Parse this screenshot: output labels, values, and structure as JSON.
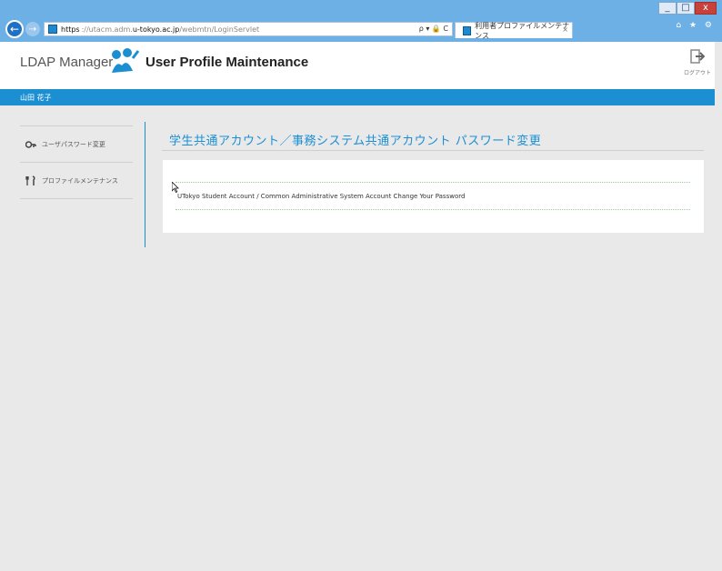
{
  "browser": {
    "url_protocol": "https",
    "url_host_prefix": "://utacm.adm.",
    "url_domain": "u-tokyo.ac.jp",
    "url_path": "/webmtn/LoginServlet",
    "address_icons": "ρ ▾ 🔒 C",
    "tab_title": "利用者プロファイルメンテナンス",
    "tab_close": "×",
    "window_buttons": [
      "_",
      "□",
      "x"
    ],
    "corner_icons": "⌂ ★ ⚙"
  },
  "app": {
    "brand": "LDAP Manager",
    "title": "User Profile Maintenance",
    "logout_label": "ログアウト",
    "user_name": "山田 花子"
  },
  "sidebar": {
    "items": [
      {
        "label": "ユーザパスワード変更",
        "icon": "key-icon"
      },
      {
        "label": "プロファイルメンテナンス",
        "icon": "tools-icon"
      }
    ]
  },
  "main": {
    "heading": "学生共通アカウント／事務システム共通アカウント パスワード変更",
    "link_text": "UTokyo Student Account / Common Administrative System Account Change Your Password"
  },
  "colors": {
    "accent": "#1b8fd2",
    "titlebar": "#6cb0e6",
    "close_button": "#c8423b"
  }
}
